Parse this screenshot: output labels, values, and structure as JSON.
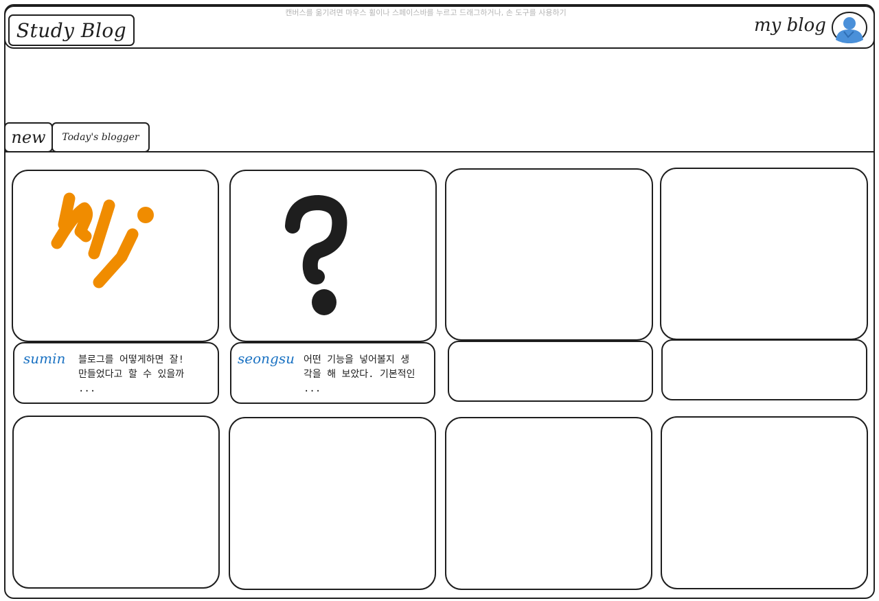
{
  "canvas_hint": "캔버스를 옮기려면 마우스 휠이나 스페이스바를 누르고 드래그하거나, 손 도구를 사용하기",
  "header": {
    "logo": "Study Blog",
    "my_blog_link": "my blog",
    "avatar_icon": "user-avatar-icon"
  },
  "tabs": [
    {
      "label": "new"
    },
    {
      "label": "Today's blogger"
    }
  ],
  "posts": [
    {
      "thumbnail_icon": "sj-initials-drawing",
      "author": "sumin",
      "excerpt_lines": [
        "블로그를 어떻게하면 잘!",
        "만들었다고 할 수 있을까",
        "..."
      ]
    },
    {
      "thumbnail_icon": "question-mark-icon",
      "author": "seongsu",
      "excerpt_lines": [
        "어떤 기능을 넣어볼지 생",
        "각을 해 보았다. 기본적인",
        "..."
      ]
    },
    {
      "thumbnail_icon": "",
      "author": "",
      "excerpt_lines": []
    },
    {
      "thumbnail_icon": "",
      "author": "",
      "excerpt_lines": []
    }
  ],
  "colors": {
    "ink": "#1e1e1e",
    "accent_blue": "#1971c2",
    "sketch_orange": "#f08c00",
    "avatar_blue": "#4a90d9"
  }
}
